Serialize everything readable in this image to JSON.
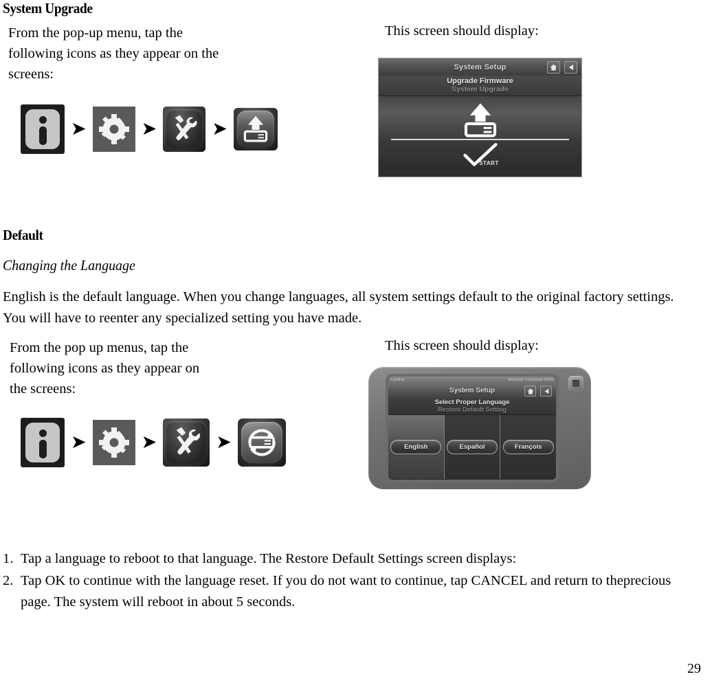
{
  "page": {
    "number": "29"
  },
  "section_upgrade": {
    "heading": "System Upgrade",
    "instruction": "From the pop-up menu, tap the following icons as they appear on the screens:",
    "screen_caption": "This screen should display:",
    "icon_flow": [
      {
        "name": "info-icon",
        "label": "i"
      },
      {
        "name": "arrow-icon",
        "label": "➔"
      },
      {
        "name": "gear-icon",
        "label": ""
      },
      {
        "name": "arrow-icon",
        "label": "➔"
      },
      {
        "name": "tools-icon",
        "label": ""
      },
      {
        "name": "arrow-icon",
        "label": "➔"
      },
      {
        "name": "system-upgrade-icon",
        "label": ""
      }
    ],
    "device_screen": {
      "title": "System Setup",
      "menu_main": "Upgrade Firmware",
      "menu_sub": "System Upgrade",
      "start_label": "START",
      "home_icon": "home-icon",
      "back_icon": "back-icon"
    }
  },
  "section_default": {
    "heading": "Default",
    "subheading": "Changing the Language",
    "paragraph": "English is the default language. When you change languages, all system settings default to the original factory settings. You will have to reenter any specialized setting you have made.",
    "instruction": "From the pop up menus, tap the following icons as they appear on the screens:",
    "screen_caption": "This screen should display:",
    "icon_flow": [
      {
        "name": "info-icon",
        "label": "i"
      },
      {
        "name": "arrow-icon",
        "label": "➔"
      },
      {
        "name": "gear-icon",
        "label": ""
      },
      {
        "name": "arrow-icon",
        "label": "➔"
      },
      {
        "name": "tools-icon",
        "label": ""
      },
      {
        "name": "arrow-icon",
        "label": "➔"
      },
      {
        "name": "restore-default-icon",
        "label": ""
      }
    ],
    "device_screen": {
      "status_left": "Loading",
      "status_right": "Bluetooth  Connected  100%",
      "title": "System Setup",
      "menu_main": "Select Proper Language",
      "menu_sub": "Restore Default Setting",
      "languages": [
        {
          "label": "English"
        },
        {
          "label": "Español"
        },
        {
          "label": "François"
        }
      ],
      "home_icon": "home-icon",
      "back_icon": "back-icon"
    },
    "steps": [
      {
        "num": "1.",
        "text": "Tap a language to reboot to that language. The Restore Default Settings screen displays:"
      },
      {
        "num": "2.",
        "text": "Tap OK to continue with the language reset. If you do not want to continue, tap CANCEL and return to theprecious page. The system will reboot in about 5 seconds."
      }
    ]
  },
  "colors": {
    "page_bg": "#ffffff",
    "text": "#000000",
    "device_bezel": "#747474",
    "screen_bg": "#2e2e2e",
    "screen_title_text": "#d8d8d8",
    "menu_active_text": "#e6e6e6",
    "menu_inactive_text": "#8e8e8e"
  }
}
